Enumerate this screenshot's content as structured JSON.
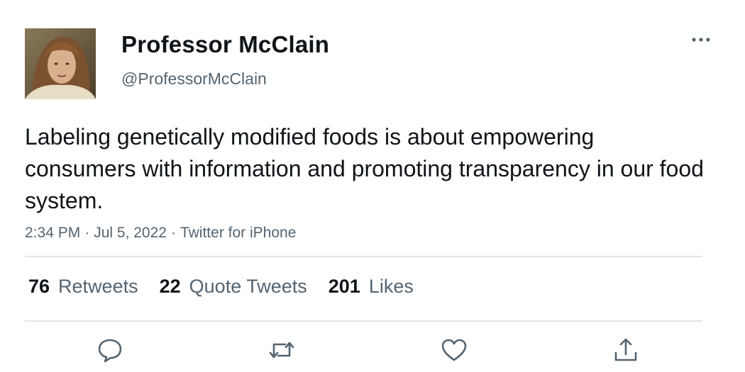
{
  "user": {
    "display_name": "Professor McClain",
    "handle": "@ProfessorMcClain"
  },
  "tweet": {
    "text": "Labeling genetically modified foods is about empowering consumers with information and promoting transparency in our food system.",
    "time": "2:34 PM",
    "date": "Jul 5, 2022",
    "source": "Twitter for iPhone",
    "separator": "·"
  },
  "stats": {
    "retweets_count": "76",
    "retweets_label": "Retweets",
    "quotes_count": "22",
    "quotes_label": "Quote Tweets",
    "likes_count": "201",
    "likes_label": "Likes"
  },
  "icons": {
    "more": "more-horizontal-icon",
    "reply": "reply-icon",
    "retweet": "retweet-icon",
    "like": "heart-icon",
    "share": "share-icon"
  },
  "colors": {
    "text_primary": "#0f1419",
    "text_secondary": "#536471",
    "divider": "#e1e4e8"
  }
}
